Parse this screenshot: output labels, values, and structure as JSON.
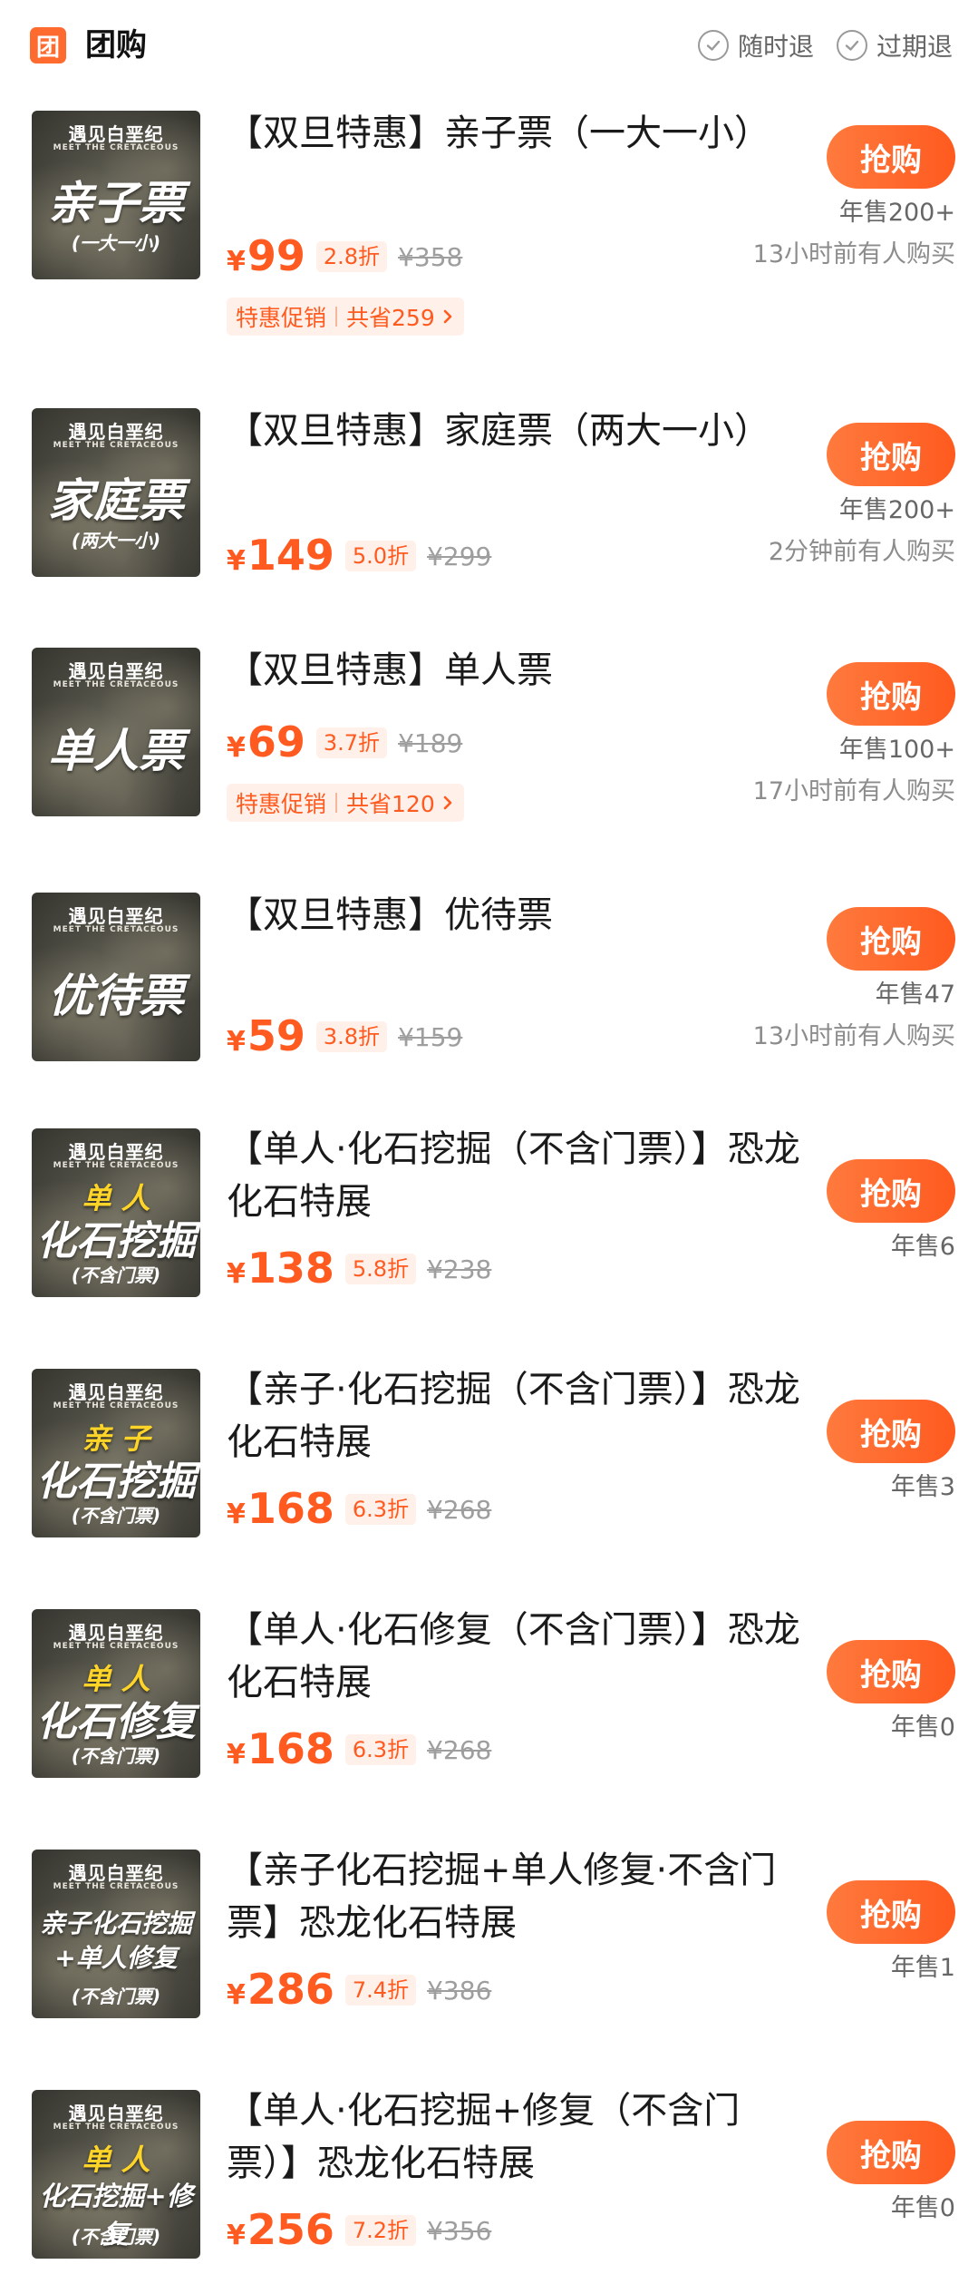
{
  "header": {
    "badge": "团",
    "title": "团购",
    "tags": [
      "随时退",
      "过期退"
    ]
  },
  "colors": {
    "accent": "#ff5a1f",
    "badge_bg": "#fff1ea"
  },
  "items": [
    {
      "title": "【双旦特惠】亲子票（一大一小）",
      "price_symbol": "¥",
      "price": "99",
      "discount": "2.8折",
      "original": "¥358",
      "promo": {
        "label": "特惠促销",
        "saving": "共省259"
      },
      "button": "抢购",
      "sold": "年售200+",
      "recent": "13小时前有人购买",
      "thumb": {
        "brand": "遇见白垩纪",
        "brand_sub": "MEET THE CRETACEOUS",
        "line1": "亲子票",
        "line2": "(一大一小)"
      }
    },
    {
      "title": "【双旦特惠】家庭票（两大一小）",
      "price_symbol": "¥",
      "price": "149",
      "discount": "5.0折",
      "original": "¥299",
      "button": "抢购",
      "sold": "年售200+",
      "recent": "2分钟前有人购买",
      "thumb": {
        "brand": "遇见白垩纪",
        "brand_sub": "MEET THE CRETACEOUS",
        "line1": "家庭票",
        "line2": "(两大一小)"
      }
    },
    {
      "title": "【双旦特惠】单人票",
      "price_symbol": "¥",
      "price": "69",
      "discount": "3.7折",
      "original": "¥189",
      "promo": {
        "label": "特惠促销",
        "saving": "共省120"
      },
      "button": "抢购",
      "sold": "年售100+",
      "recent": "17小时前有人购买",
      "thumb": {
        "brand": "遇见白垩纪",
        "brand_sub": "MEET THE CRETACEOUS",
        "line1": "单人票"
      }
    },
    {
      "title": "【双旦特惠】优待票",
      "price_symbol": "¥",
      "price": "59",
      "discount": "3.8折",
      "original": "¥159",
      "button": "抢购",
      "sold": "年售47",
      "recent": "13小时前有人购买",
      "thumb": {
        "brand": "遇见白垩纪",
        "brand_sub": "MEET THE CRETACEOUS",
        "line1": "优待票"
      }
    },
    {
      "title": "【单人·化石挖掘（不含门票）】恐龙化石特展",
      "price_symbol": "¥",
      "price": "138",
      "discount": "5.8折",
      "original": "¥238",
      "button": "抢购",
      "sold": "年售6",
      "thumb": {
        "brand": "遇见白垩纪",
        "brand_sub": "MEET THE CRETACEOUS",
        "yellow": "单 人",
        "line1": "化石挖掘",
        "line2": "(不含门票)"
      }
    },
    {
      "title": "【亲子·化石挖掘（不含门票）】恐龙化石特展",
      "price_symbol": "¥",
      "price": "168",
      "discount": "6.3折",
      "original": "¥268",
      "button": "抢购",
      "sold": "年售3",
      "thumb": {
        "brand": "遇见白垩纪",
        "brand_sub": "MEET THE CRETACEOUS",
        "yellow": "亲 子",
        "line1": "化石挖掘",
        "line2": "(不含门票)"
      }
    },
    {
      "title": "【单人·化石修复（不含门票）】恐龙化石特展",
      "price_symbol": "¥",
      "price": "168",
      "discount": "6.3折",
      "original": "¥268",
      "button": "抢购",
      "sold": "年售0",
      "thumb": {
        "brand": "遇见白垩纪",
        "brand_sub": "MEET THE CRETACEOUS",
        "yellow": "单 人",
        "line1": "化石修复",
        "line2": "(不含门票)"
      }
    },
    {
      "title": "【亲子化石挖掘+单人修复·不含门票】恐龙化石特展",
      "price_symbol": "¥",
      "price": "286",
      "discount": "7.4折",
      "original": "¥386",
      "button": "抢购",
      "sold": "年售1",
      "thumb": {
        "brand": "遇见白垩纪",
        "brand_sub": "MEET THE CRETACEOUS",
        "line1": "亲子化石挖掘",
        "line1b": "+单人修复",
        "line2": "(不含门票)"
      }
    },
    {
      "title": "【单人·化石挖掘+修复（不含门票）】恐龙化石特展",
      "price_symbol": "¥",
      "price": "256",
      "discount": "7.2折",
      "original": "¥356",
      "button": "抢购",
      "sold": "年售0",
      "thumb": {
        "brand": "遇见白垩纪",
        "brand_sub": "MEET THE CRETACEOUS",
        "yellow": "单 人",
        "line1": "化石挖掘+修复",
        "line2": "(不含门票)"
      }
    }
  ]
}
